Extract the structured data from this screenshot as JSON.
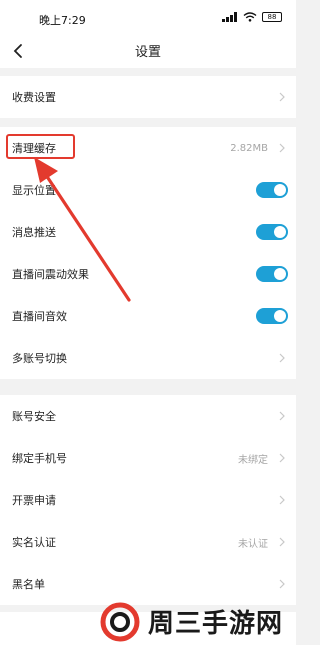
{
  "status_bar": {
    "time": "晚上7:29",
    "battery": "88"
  },
  "nav": {
    "title": "设置"
  },
  "groups": [
    {
      "items": [
        {
          "label": "收费设置"
        }
      ]
    },
    {
      "items": [
        {
          "label": "清理缓存",
          "value": "2.82MB"
        },
        {
          "label": "显示位置",
          "toggle": true
        },
        {
          "label": "消息推送",
          "toggle": true
        },
        {
          "label": "直播间震动效果",
          "toggle": true
        },
        {
          "label": "直播间音效",
          "toggle": true
        },
        {
          "label": "多账号切换"
        }
      ]
    },
    {
      "items": [
        {
          "label": "账号安全"
        },
        {
          "label": "绑定手机号",
          "value": "未绑定"
        },
        {
          "label": "开票申请"
        },
        {
          "label": "实名认证",
          "value": "未认证"
        },
        {
          "label": "黑名单"
        }
      ]
    }
  ],
  "watermark": {
    "text": "周三手游网"
  },
  "colors": {
    "toggle_on": "#1ea0d6",
    "highlight": "#e33a2e"
  }
}
